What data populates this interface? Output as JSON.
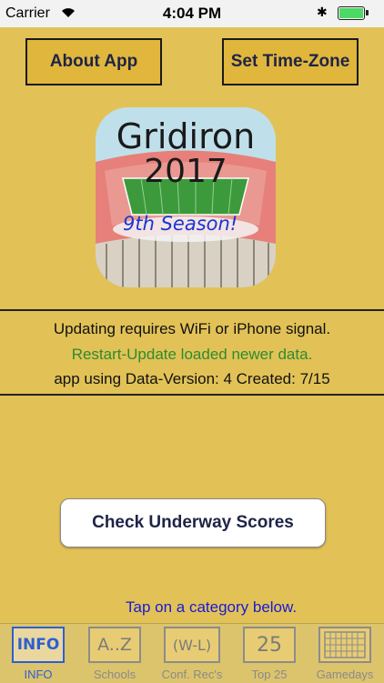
{
  "status_bar": {
    "carrier": "Carrier",
    "time": "4:04 PM"
  },
  "buttons": {
    "about": "About App",
    "timezone": "Set Time-Zone",
    "check_scores": "Check Underway Scores"
  },
  "logo": {
    "title": "Gridiron",
    "year": "2017",
    "season": "9th Season!"
  },
  "info": {
    "line1": "Updating requires WiFi or iPhone signal.",
    "line2": "Restart-Update loaded newer data.",
    "line3": "app using Data-Version: 4 Created: 7/15"
  },
  "hint": "Tap on a category below.",
  "tabs": [
    {
      "icon_text": "INFO",
      "label": "INFO",
      "icon": "info-icon",
      "active": true
    },
    {
      "icon_text": "A..Z",
      "label": "Schools",
      "icon": "a-z-icon",
      "active": false
    },
    {
      "icon_text": "(W-L)",
      "label": "Conf. Rec's",
      "icon": "win-loss-icon",
      "active": false
    },
    {
      "icon_text": "25",
      "label": "Top 25",
      "icon": "top25-icon",
      "active": false
    },
    {
      "icon_text": "",
      "label": "Gamedays",
      "icon": "calendar-icon",
      "active": false
    }
  ],
  "colors": {
    "background": "#E2C257",
    "accent": "#2e5fd1",
    "green_text": "#2E8B2E",
    "hint_blue": "#1a1ad6"
  }
}
